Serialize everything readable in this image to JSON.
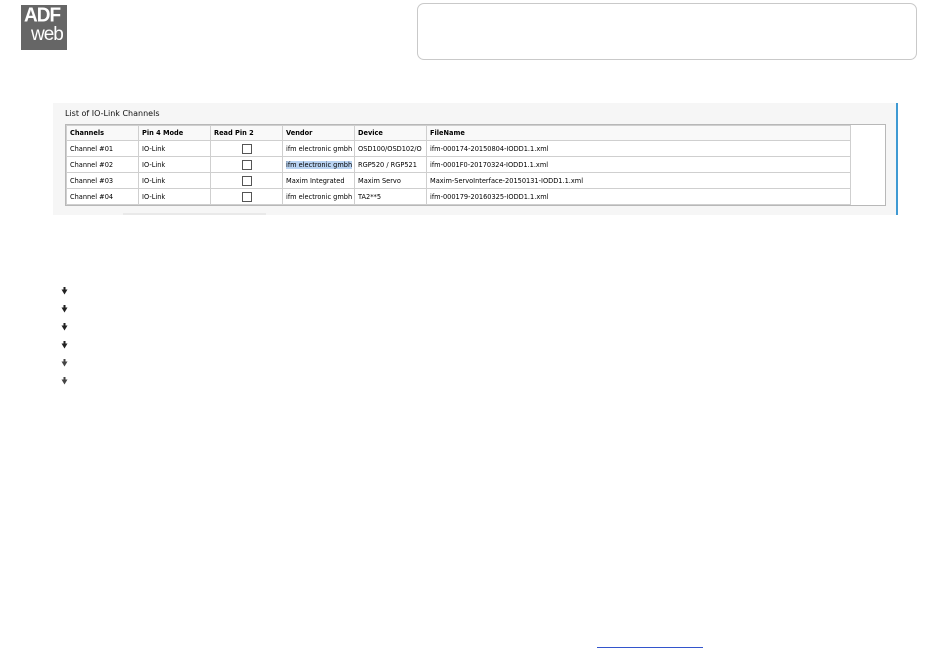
{
  "logo": {
    "line1": "ADF",
    "line2": "web"
  },
  "panel": {
    "title": "List of IO-Link Channels",
    "columns": [
      "Channels",
      "Pin 4 Mode",
      "Read Pin 2",
      "Vendor",
      "Device",
      "FileName"
    ],
    "rows": [
      {
        "channel": "Channel #01",
        "mode": "IO-Link",
        "read_pin2": false,
        "vendor": "ifm electronic gmbh",
        "device": "OSD100/OSD102/O",
        "filename": "ifm-000174-20150804-IODD1.1.xml"
      },
      {
        "channel": "Channel #02",
        "mode": "IO-Link",
        "read_pin2": false,
        "vendor": "ifm electronic gmbh",
        "device": "RGP520 / RGP521",
        "filename": "ifm-0001F0-20170324-IODD1.1.xml"
      },
      {
        "channel": "Channel #03",
        "mode": "IO-Link",
        "read_pin2": false,
        "vendor": "Maxim Integrated",
        "device": "Maxim Servo",
        "filename": "Maxim-ServoInterface-20150131-IODD1.1.xml"
      },
      {
        "channel": "Channel #04",
        "mode": "IO-Link",
        "read_pin2": false,
        "vendor": "ifm electronic gmbh",
        "device": "TA2**5",
        "filename": "ifm-000179-20160325-IODD1.1.xml"
      }
    ],
    "selected_cell": "Channel #02 vendor"
  },
  "bullets": [
    "bullet-icon",
    "bullet-icon",
    "bullet-icon",
    "bullet-icon",
    "bullet-icon",
    "bullet-icon"
  ],
  "colors": {
    "panel_accent": "#3f9ad3",
    "selection": "#b9d3f2",
    "logo_bg": "#666666"
  }
}
